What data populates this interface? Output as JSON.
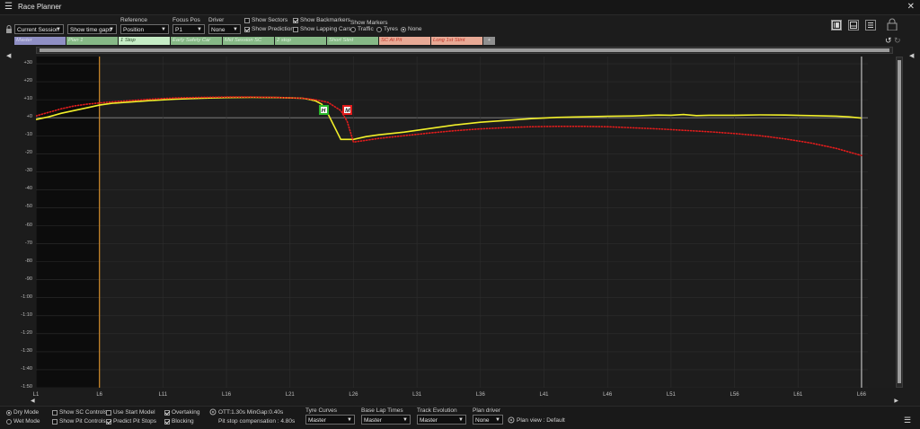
{
  "window": {
    "title": "Race Planner"
  },
  "toolbar": {
    "session": "Current Session",
    "gaps_mode": "Show time gaps",
    "reference_label": "Reference",
    "reference_value": "Position",
    "focus_label": "Focus Pos",
    "focus_value": "P1",
    "driver_label": "Driver",
    "driver_value": "None",
    "show_sectors": "Show Sectors",
    "show_prediction": "Show Prediction",
    "show_backmarkers": "Show Backmarkers",
    "show_lapping_cars": "Show Lapping Cars",
    "show_markers_label": "Show Markers",
    "marker_traffic": "Traffic",
    "marker_tyres": "Tyres",
    "marker_none": "None"
  },
  "strategy_tabs": [
    {
      "label": "Master",
      "bg": "#8f8fc4",
      "fg": "#d6d6f0"
    },
    {
      "label": "Plan 1",
      "bg": "#86b886",
      "fg": "#d9f0d9"
    },
    {
      "label": "1 Stop",
      "bg": "#c5ecc5",
      "fg": "#2a4a2a"
    },
    {
      "label": "Early Safety Car",
      "bg": "#86b886",
      "fg": "#d9f0d9"
    },
    {
      "label": "Mid Session SC",
      "bg": "#86b886",
      "fg": "#d9f0d9"
    },
    {
      "label": "2 stop",
      "bg": "#86b886",
      "fg": "#d9f0d9"
    },
    {
      "label": "Short Stint",
      "bg": "#86b886",
      "fg": "#d9f0d9"
    },
    {
      "label": "SC At Pit",
      "bg": "#e8a995",
      "fg": "#c0392b"
    },
    {
      "label": "Long 1st Stint",
      "bg": "#e8a995",
      "fg": "#c0392b"
    },
    {
      "label": "+",
      "bg": "#8f8f8f",
      "fg": "#e0e0e0"
    }
  ],
  "chart_data": {
    "type": "line",
    "x_tick_labels": [
      "L1",
      "L6",
      "L11",
      "L16",
      "L21",
      "L26",
      "L31",
      "L36",
      "L41",
      "L46",
      "L51",
      "L56",
      "L61",
      "L66"
    ],
    "x_ticks": [
      1,
      6,
      11,
      16,
      21,
      26,
      31,
      36,
      41,
      46,
      51,
      56,
      61,
      66
    ],
    "xlim": [
      1,
      66.5
    ],
    "y_tick_labels": [
      "+30",
      "+20",
      "+10",
      "+0",
      "-10",
      "-20",
      "-30",
      "-40",
      "-50",
      "-60",
      "-70",
      "-80",
      "-90",
      "-1:00",
      "-1:10",
      "-1:20",
      "-1:30",
      "-1:40",
      "-1:50"
    ],
    "y_ticks": [
      30,
      20,
      10,
      0,
      -10,
      -20,
      -30,
      -40,
      -50,
      -60,
      -70,
      -80,
      -90,
      -100,
      -110,
      -120,
      -130,
      -140,
      -150
    ],
    "ylim": [
      -150,
      34
    ],
    "grid": true,
    "current_lap_marker": 6,
    "series": [
      {
        "color": "#f2f02a",
        "style": "solid",
        "x": [
          1,
          2,
          3,
          4,
          5,
          6,
          7,
          8,
          10,
          12,
          14,
          16,
          18,
          20,
          21,
          22,
          22.5,
          23,
          23.5,
          24,
          25,
          26,
          27,
          28,
          30,
          32,
          34,
          36,
          38,
          40,
          42,
          44,
          46,
          48,
          50,
          51,
          52,
          53,
          54,
          56,
          58,
          60,
          62,
          64,
          65,
          66
        ],
        "y": [
          -1,
          0.5,
          2.5,
          4,
          5.5,
          7,
          8,
          8.5,
          9.5,
          10.3,
          10.8,
          11.2,
          11.3,
          11.2,
          11,
          10.8,
          10.2,
          9.4,
          7.5,
          2,
          -12,
          -12,
          -10.5,
          -9.5,
          -8,
          -6,
          -4,
          -2.5,
          -1.5,
          -0.5,
          0.2,
          0.5,
          0.8,
          1,
          1.5,
          1.4,
          1.8,
          1.2,
          1.4,
          1.4,
          1.6,
          1.5,
          1.2,
          0.9,
          0.5,
          -0.2
        ]
      },
      {
        "color": "#e01c1c",
        "style": "dotted",
        "x": [
          1,
          2,
          3,
          4,
          5,
          6,
          7,
          8,
          10,
          12,
          14,
          16,
          18,
          20,
          22,
          23,
          24,
          25,
          25.5,
          26,
          27,
          28,
          30,
          32,
          34,
          36,
          38,
          40,
          42,
          44,
          46,
          48,
          50,
          52,
          54,
          56,
          58,
          60,
          62,
          64,
          66
        ],
        "y": [
          1,
          3,
          5,
          6.5,
          7.5,
          8.2,
          8.8,
          9.3,
          10.3,
          11,
          11.3,
          11.5,
          11.5,
          11.3,
          10.8,
          10,
          8.5,
          4,
          -2,
          -13.5,
          -12.5,
          -11.5,
          -10,
          -8.5,
          -7.2,
          -6.2,
          -5.5,
          -5,
          -4.8,
          -4.8,
          -5,
          -5.6,
          -6.2,
          -7,
          -7.8,
          -8.8,
          -10,
          -11.8,
          -14,
          -17,
          -21
        ]
      }
    ],
    "annotations": [
      {
        "text": "H",
        "x": 23.6,
        "y": 4.5,
        "border": "#2db82d"
      },
      {
        "text": "M",
        "x": 25.5,
        "y": 4.5,
        "border": "#e01c1c"
      }
    ]
  },
  "bottom": {
    "dry_mode": "Dry Mode",
    "wet_mode": "Wet Mode",
    "show_sc_controls": "Show SC Controls",
    "show_pit_controls": "Show Pit Controls",
    "use_start_model": "Use Start Model",
    "predict_pit_stops": "Predict Pit Stops",
    "overtaking": "Overtaking",
    "blocking": "Blocking",
    "ott_info": "OTT:1.30s MinGap:0.40s",
    "pit_comp": "Pit stop compensation : 4.80s",
    "tyre_curves_label": "Tyre Curves",
    "tyre_curves_value": "Master",
    "base_lap_label": "Base Lap Times",
    "base_lap_value": "Master",
    "track_evo_label": "Track Evolution",
    "track_evo_value": "Master",
    "plan_driver_label": "Plan driver",
    "plan_driver_value": "None",
    "plan_view": "Plan view : Default"
  },
  "icons": [
    "menu-icon",
    "close-icon",
    "lock-icon",
    "view-single-icon",
    "view-split-icon",
    "view-list-icon",
    "undo-icon",
    "redo-icon",
    "collapse-left-icon",
    "collapse-right-icon",
    "settings-icon",
    "hamburger-icon"
  ]
}
